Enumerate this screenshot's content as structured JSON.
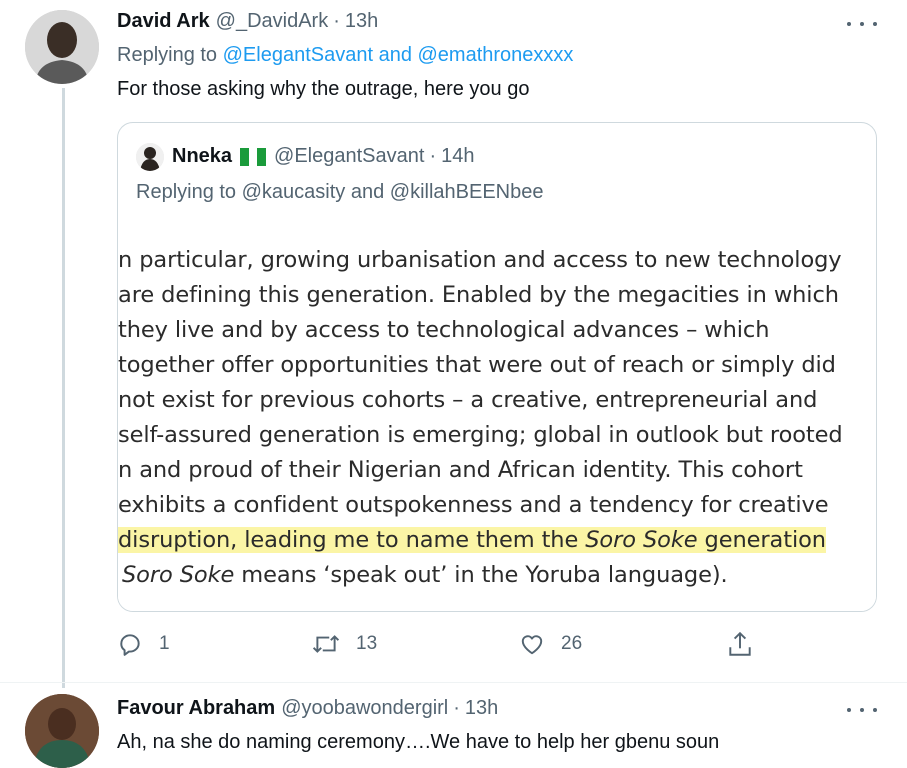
{
  "tweet1": {
    "name": "David Ark",
    "handle": "@_DavidArk",
    "dot": "·",
    "time": "13h",
    "replying_prefix": "Replying to",
    "replying_links": "@ElegantSavant and @emathronexxxx",
    "text": "For those asking why the outrage, here you go",
    "quote": {
      "name": "Nneka",
      "flag": "Nigeria flag",
      "handle": "@ElegantSavant",
      "dot": "·",
      "time": "14h",
      "replying": "Replying to @kaucasity and @killahBEENbee",
      "image_lines": [
        "n particular, growing urbanisation and access to new technology",
        "are defining this generation. Enabled by the megacities in which",
        "they live and by access to technological advances – which",
        "together offer opportunities that were out of reach or simply did",
        "not exist for previous cohorts – a creative, entrepreneurial and",
        "self-assured generation is emerging; global in outlook but rooted",
        "n and proud of their Nigerian and African identity. This cohort",
        "exhibits a confident outspokenness and a tendency for creative"
      ],
      "hl_line_pre": "disruption, leading me to name them the ",
      "hl_line_em": "Soro Soke",
      "hl_line_post": " generation",
      "last_line_em": "Soro Soke",
      "last_line_post": " means ‘speak out’ in the Yoruba language)."
    },
    "actions": {
      "replies": "1",
      "retweets": "13",
      "likes": "26"
    }
  },
  "tweet2": {
    "name": "Favour Abraham",
    "handle": "@yoobawondergirl",
    "dot": "·",
    "time": "13h",
    "text": "Ah, na she do naming ceremony….We have to help her gbenu soun"
  },
  "icons": {
    "reply": "reply-icon",
    "retweet": "retweet-icon",
    "like": "heart-icon",
    "share": "share-icon",
    "more": "more-icon"
  },
  "colors": {
    "link": "#1d9bf0",
    "secondary": "#536471",
    "highlight": "#fbf5a6",
    "border": "#cfd9de"
  }
}
